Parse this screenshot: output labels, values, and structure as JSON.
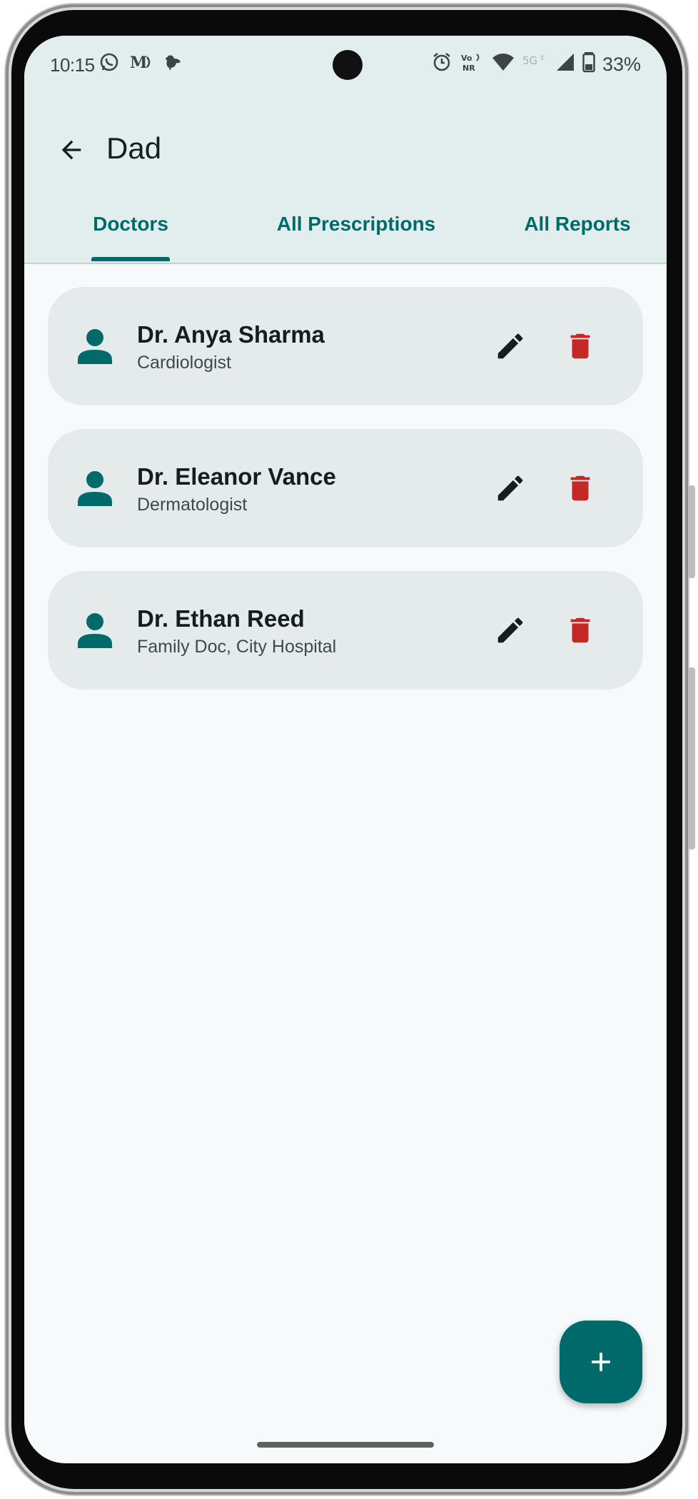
{
  "status_bar": {
    "time": "10:15",
    "notifications": [
      "whatsapp-icon",
      "medium-icon",
      "bird-icon"
    ],
    "system_icons": [
      "alarm-icon",
      "vonr-icon",
      "wifi-icon",
      "5g-icon",
      "signal-icon",
      "battery-icon"
    ],
    "battery": "33%"
  },
  "app_bar": {
    "title": "Dad",
    "back_icon": "arrow-back-icon"
  },
  "tabs": [
    {
      "label": "Doctors",
      "selected": true
    },
    {
      "label": "All Prescriptions",
      "selected": false
    },
    {
      "label": "All Reports",
      "selected": false
    }
  ],
  "doctors": [
    {
      "name": "Dr. Anya Sharma",
      "specialty": "Cardiologist"
    },
    {
      "name": "Dr. Eleanor Vance",
      "specialty": "Dermatologist"
    },
    {
      "name": "Dr. Ethan Reed",
      "specialty": "Family Doc, City Hospital"
    }
  ],
  "fab": {
    "icon": "plus-icon"
  },
  "colors": {
    "accent": "#006a6a",
    "delete": "#c62828",
    "card_bg": "#e5ebea",
    "topbar_bg": "#e2eded",
    "screen_bg": "#f6fafa"
  }
}
